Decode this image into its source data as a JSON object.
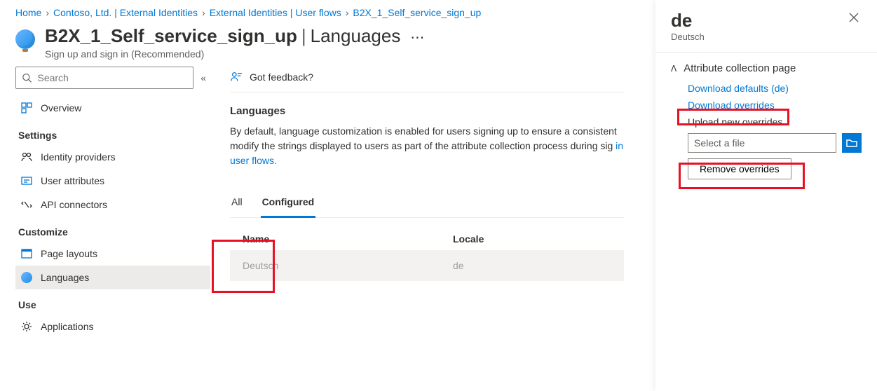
{
  "breadcrumb": [
    {
      "label": "Home"
    },
    {
      "label": "Contoso, Ltd. | External Identities"
    },
    {
      "label": "External Identities | User flows"
    },
    {
      "label": "B2X_1_Self_service_sign_up"
    }
  ],
  "header": {
    "title": "B2X_1_Self_service_sign_up",
    "section": "Languages",
    "subtitle": "Sign up and sign in (Recommended)"
  },
  "search": {
    "placeholder": "Search"
  },
  "sidebar": {
    "overview": "Overview",
    "settings_header": "Settings",
    "identity_providers": "Identity providers",
    "user_attributes": "User attributes",
    "api_connectors": "API connectors",
    "customize_header": "Customize",
    "page_layouts": "Page layouts",
    "languages": "Languages",
    "use_header": "Use",
    "applications": "Applications"
  },
  "main": {
    "feedback": "Got feedback?",
    "heading": "Languages",
    "description_prefix": "By default, language customization is enabled for users signing up to ensure a consistent modify the strings displayed to users as part of the attribute collection process during sig",
    "description_link": "in user flows.",
    "tabs": {
      "all": "All",
      "configured": "Configured"
    },
    "columns": {
      "name": "Name",
      "locale": "Locale"
    },
    "row": {
      "name": "Deutsch",
      "locale": "de"
    }
  },
  "panel": {
    "title": "de",
    "subtitle": "Deutsch",
    "section": "Attribute collection page",
    "download_defaults": "Download defaults (de)",
    "download_overrides": "Download overrides",
    "upload_label": "Upload new overrides",
    "file_placeholder": "Select a file",
    "remove": "Remove overrides"
  }
}
